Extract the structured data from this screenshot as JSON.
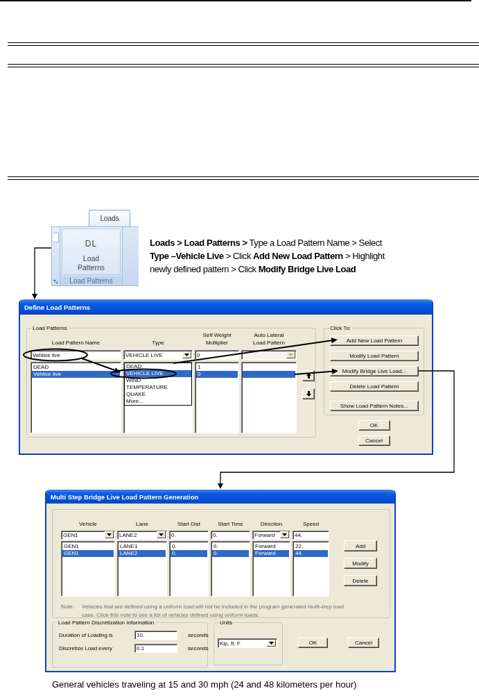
{
  "ribbon": {
    "tab": "Loads",
    "button_icon_text": "DL",
    "button_label": "Load Patterns",
    "group_label": "Load Patterns"
  },
  "instructions": "**Loads > Load Patterns >** Type a Load Pattern Name > Select **Type –Vehicle Live** > Click **Add New Load Pattern** > Highlight newly defined pattern > Click **Modify Bridge Live Load**",
  "define_dialog": {
    "title": "Define Load Patterns",
    "group_title": "Load Patterns",
    "columns": [
      "Load Pattern Name",
      "Type",
      "Self Weight Multiplier",
      "Auto Lateral Load Pattern"
    ],
    "entry_row": [
      {
        "kind": "text",
        "value": "Vehilce live"
      },
      {
        "kind": "combo",
        "value": "VEHICLE LIVE",
        "disabled": false
      },
      {
        "kind": "text",
        "value": "0"
      },
      {
        "kind": "combo",
        "disabled": true
      }
    ],
    "rows": [
      {
        "name": "DEAD",
        "multiplier": "1",
        "selected": false
      },
      {
        "name": "Vehilce live",
        "multiplier": "0",
        "selected": true
      }
    ],
    "type_dropdown": [
      {
        "label": "DEAD",
        "selected": false
      },
      {
        "label": "VEHICLE LIVE",
        "selected": true
      },
      {
        "label": "WIND",
        "selected": false
      },
      {
        "label": "TEMPERATURE",
        "selected": false
      },
      {
        "label": "QUAKE",
        "selected": false
      },
      {
        "label": "More...",
        "selected": false
      }
    ],
    "actions_title": "Click To:",
    "actions": [
      "Add New Load Pattern",
      "Modify Load Pattern",
      "Modify Bridge Live Load...",
      "Delete Load Pattern",
      "Show Load Pattern Notes..."
    ],
    "ok": "OK",
    "cancel": "Cancel"
  },
  "bridge_dialog": {
    "title": "Multi Step Bridge Live Load Pattern Generation",
    "columns": [
      "Vehicle",
      "Lane",
      "Start Dist",
      "Start Time",
      "Direction",
      "Speed"
    ],
    "entry_row": [
      {
        "kind": "combo",
        "value": "GEN1"
      },
      {
        "kind": "combo",
        "value": "LANE2"
      },
      {
        "kind": "text",
        "value": "0."
      },
      {
        "kind": "text",
        "value": "0."
      },
      {
        "kind": "combo",
        "value": "Forward"
      },
      {
        "kind": "text",
        "value": "44."
      }
    ],
    "rows": [
      {
        "cells": [
          "GEN1",
          "LANE1",
          "0.",
          "0.",
          "Forward",
          "22."
        ],
        "selected": false
      },
      {
        "cells": [
          "GEN1",
          "LANE2",
          "0.",
          "0.",
          "Forward",
          "44."
        ],
        "selected": true
      }
    ],
    "buttons": [
      "Add",
      "Modify",
      "Delete"
    ],
    "note_label": "Note:",
    "note": "Vehicles that are defined using a uniform load will not be included in the program generated multi-step load case.  Click this note to see a list of vehicles defined using uniform loads.",
    "discretization": {
      "title": "Load Pattern Discretization Information",
      "fields": [
        {
          "label": "Duration of Loading is",
          "value": "10.",
          "unit": "seconds"
        },
        {
          "label": "Discretize Load every",
          "value": "0.1",
          "unit": "seconds"
        }
      ]
    },
    "units": {
      "title": "Units",
      "value": "Kip, ft, F"
    },
    "ok": "OK",
    "cancel": "Cancel"
  },
  "caption": "General vehicles traveling at 15 and 30 mph (24 and 48 kilometers per hour)"
}
